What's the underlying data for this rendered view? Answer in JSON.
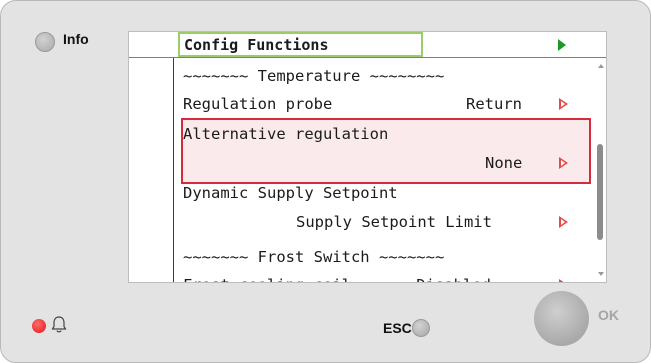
{
  "header": {
    "info_label": "Info"
  },
  "screen": {
    "title": "Config Functions",
    "rows": [
      {
        "text": "~~~~~~~ Temperature ~~~~~~~~"
      },
      {
        "label": "Regulation probe",
        "value": "Return"
      },
      {
        "label": "Alternative regulation",
        "value": "None",
        "selected": true
      },
      {
        "label": "Dynamic Supply Setpoint",
        "value": "Supply Setpoint Limit"
      },
      {
        "text": "~~~~~~~ Frost Switch ~~~~~~~"
      },
      {
        "partial": "Frost cooling coil       Disabled"
      }
    ]
  },
  "footer": {
    "esc_label": "ESC",
    "ok_label": "OK"
  },
  "colors": {
    "title_border": "#9ccc65",
    "selection_border": "#d62b3d",
    "arrow": "#e34a4a",
    "title_arrow": "#1e9a24",
    "alarm": "#e21818"
  },
  "icons": [
    "info-button",
    "bell-icon",
    "esc-button",
    "ok-button"
  ]
}
